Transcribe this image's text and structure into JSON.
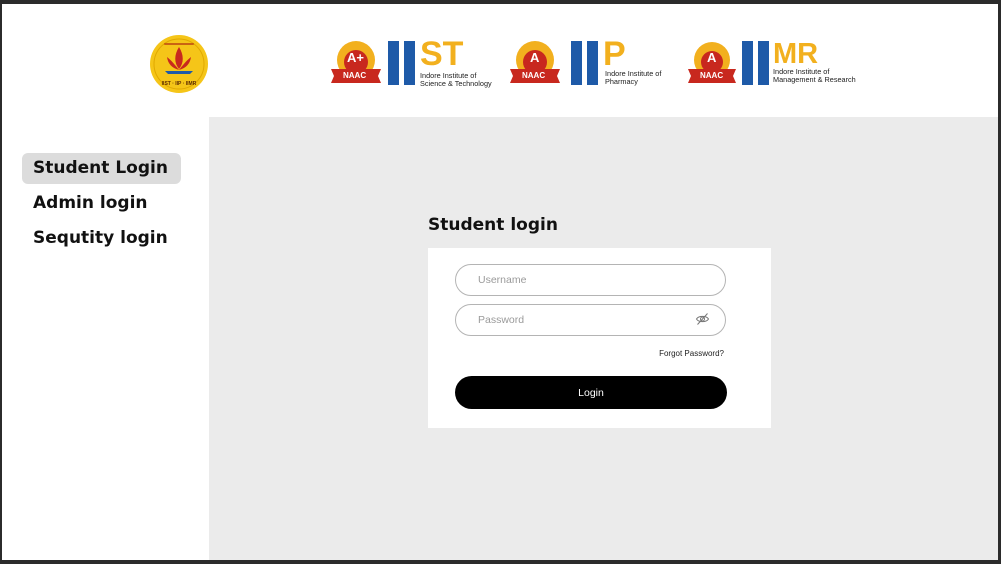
{
  "header": {
    "main_logo_caption": "IIST · IIP · IIMR",
    "institutes": [
      {
        "badge_grade": "A+",
        "badge_label": "NAAC",
        "abbr_rest": "ST",
        "name_line1": "Indore Institute of",
        "name_line2": "Science & Technology"
      },
      {
        "badge_grade": "A",
        "badge_label": "NAAC",
        "abbr_rest": "P",
        "name_line1": "Indore Institute of",
        "name_line2": "Pharmacy"
      },
      {
        "badge_grade": "A",
        "badge_label": "NAAC",
        "abbr_rest": "MR",
        "name_line1": "Indore Institute of",
        "name_line2": "Management & Research"
      }
    ]
  },
  "sidebar": {
    "items": [
      {
        "label": "Student Login",
        "active": true
      },
      {
        "label": "Admin login",
        "active": false
      },
      {
        "label": "Sequtity login",
        "active": false
      }
    ]
  },
  "form": {
    "title": "Student login",
    "username_placeholder": "Username",
    "username_value": "",
    "password_placeholder": "Password",
    "password_value": "",
    "forgot_label": "Forgot Password?",
    "login_label": "Login"
  },
  "icons": {
    "password_toggle": "eye-slash-icon"
  },
  "colors": {
    "logo_yellow": "#f5c518",
    "badge_red": "#c8281e",
    "brand_blue": "#1e5aa8",
    "brand_gold": "#f2b01e",
    "active_nav": "#dcdcdc",
    "content_bg": "#ebebeb",
    "button_bg": "#000000"
  }
}
